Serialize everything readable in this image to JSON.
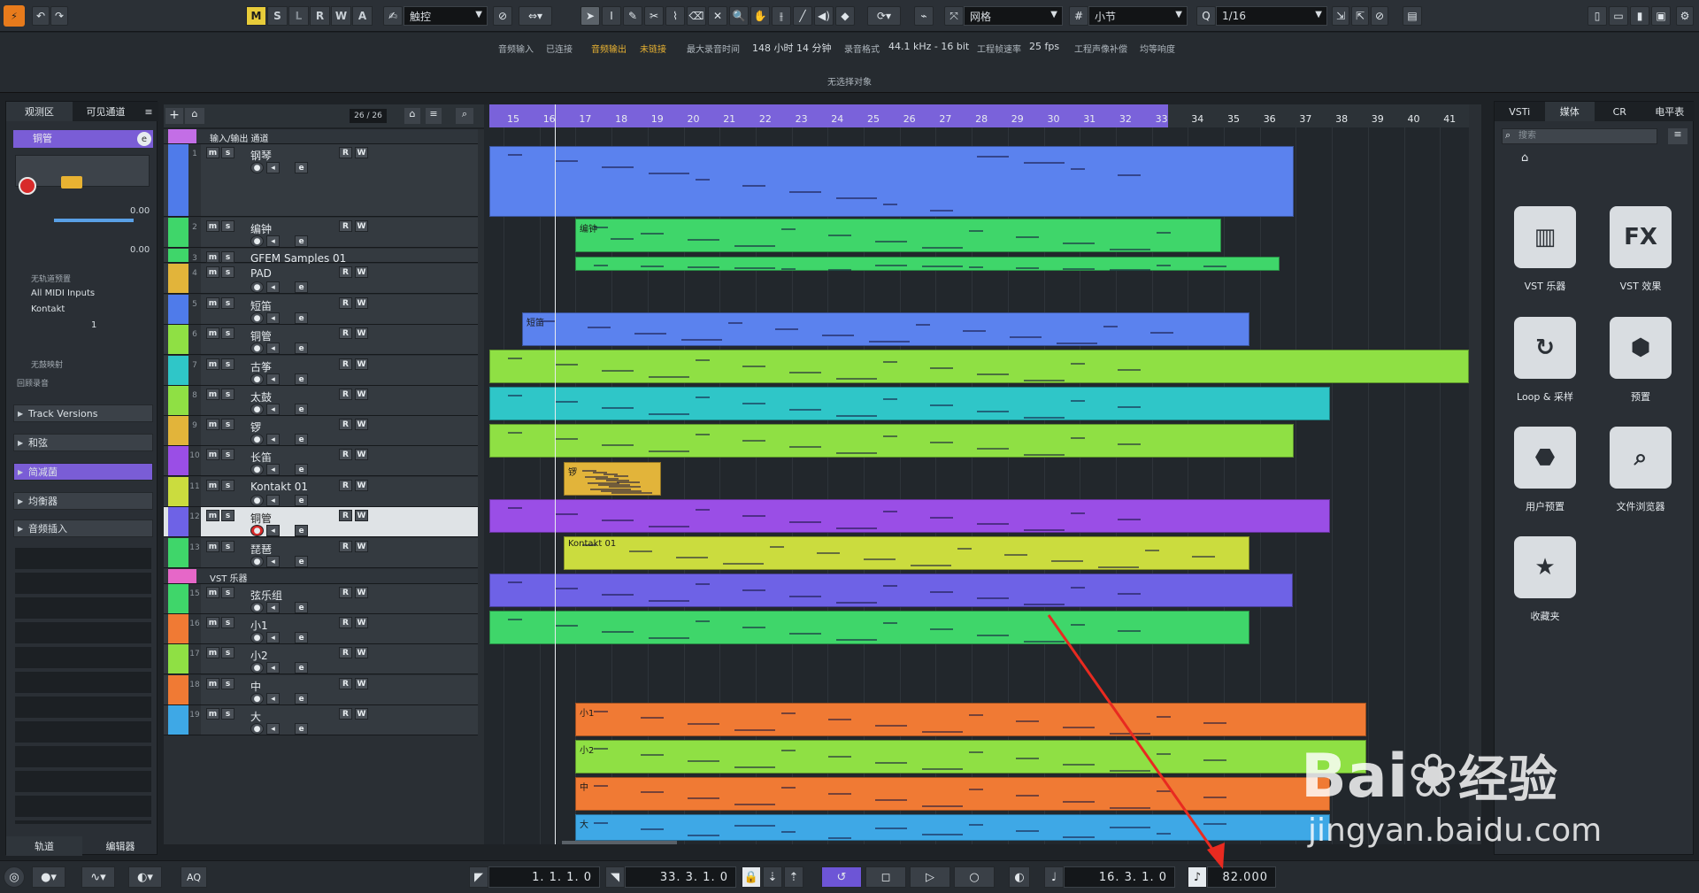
{
  "toolbar": {
    "modes": [
      "M",
      "S",
      "L",
      "R",
      "W",
      "A"
    ],
    "automation_mode": "触控",
    "grid_type": "网格",
    "grid_value": "小节",
    "quantize": "1/16"
  },
  "status": {
    "audio_input_label": "音频输入",
    "audio_input_value": "已连接",
    "audio_output_label": "音频输出",
    "audio_output_value": "未链接",
    "max_record_label": "最大录音时间",
    "max_record_value": "148 小时 14 分钟",
    "record_format_label": "录音格式",
    "record_format_value": "44.1 kHz - 16 bit",
    "frame_rate_label": "工程帧速率",
    "frame_rate_value": "25 fps",
    "pan_law_label": "工程声像补偿",
    "pan_law_value": "均等响度",
    "selection": "无选择对象"
  },
  "inspector": {
    "tabs": [
      "观测区",
      "可见通道"
    ],
    "track_name": "铜管",
    "value_a": "0.00",
    "value_b": "0.00",
    "no_preset": "无轨道预置",
    "midi_input": "All MIDI Inputs",
    "instrument": "Kontakt",
    "channel": "1",
    "no_map": "无鼓映射",
    "transpose": "回顾录音",
    "sections": [
      "Track Versions",
      "和弦",
      "简减菌",
      "均衡器",
      "音频插入"
    ],
    "bottom_tabs": [
      "轨道",
      "编辑器"
    ]
  },
  "tracklist": {
    "count": "26 / 26",
    "folder1": "输入/输出 通道",
    "folder2": "VST 乐器",
    "tracks": [
      {
        "n": "1",
        "name": "钢琴",
        "color": "#4f7bea"
      },
      {
        "n": "2",
        "name": "编钟",
        "color": "#3fd66a"
      },
      {
        "n": "3",
        "name": "GFEM Samples 01",
        "color": "#3fd66a"
      },
      {
        "n": "4",
        "name": "PAD",
        "color": "#e2b43a"
      },
      {
        "n": "5",
        "name": "短笛",
        "color": "#4f7bea"
      },
      {
        "n": "6",
        "name": "铜管",
        "color": "#8fe044"
      },
      {
        "n": "7",
        "name": "古筝",
        "color": "#2fc6c8"
      },
      {
        "n": "8",
        "name": "太鼓",
        "color": "#8fe044"
      },
      {
        "n": "9",
        "name": "锣",
        "color": "#e2b43a"
      },
      {
        "n": "10",
        "name": "长笛",
        "color": "#9a4ee6"
      },
      {
        "n": "11",
        "name": "Kontakt 01",
        "color": "#cbdc3e"
      },
      {
        "n": "12",
        "name": "铜管",
        "color": "#6e62e6"
      },
      {
        "n": "13",
        "name": "琵琶",
        "color": "#3fd66a"
      },
      {
        "n": "15",
        "name": "弦乐组",
        "color": "#3fd66a"
      },
      {
        "n": "16",
        "name": "小1",
        "color": "#f07a34"
      },
      {
        "n": "17",
        "name": "小2",
        "color": "#8fe044"
      },
      {
        "n": "18",
        "name": "中",
        "color": "#f07a34"
      },
      {
        "n": "19",
        "name": "大",
        "color": "#3ea8e6"
      }
    ]
  },
  "ruler": [
    "15",
    "16",
    "17",
    "18",
    "19",
    "20",
    "21",
    "22",
    "23",
    "24",
    "25",
    "26",
    "27",
    "28",
    "29",
    "30",
    "31",
    "32",
    "33",
    "34",
    "35",
    "36",
    "37",
    "38",
    "39",
    "40",
    "41"
  ],
  "clips": {
    "bell": "编钟",
    "piccolo": "短笛",
    "gong": "锣",
    "kontakt": "Kontakt 01",
    "s1": "小1",
    "s2": "小2",
    "mid": "中",
    "big": "大"
  },
  "right": {
    "tabs": [
      "VSTi",
      "媒体",
      "CR",
      "电平表"
    ],
    "search_placeholder": "搜索",
    "tiles": [
      "VST 乐器",
      "VST 效果",
      "Loop & 采样",
      "预置",
      "用户预置",
      "文件浏览器",
      "收藏夹"
    ]
  },
  "transport": {
    "left_locator": "1. 1. 1.   0",
    "right_locator": "33. 3. 1.   0",
    "position": "16. 3. 1.   0",
    "tempo": "82.000",
    "aq": "AQ"
  },
  "watermark": {
    "brand": "Bai",
    "brand2": "经验",
    "url": "jingyan.baidu.com"
  }
}
